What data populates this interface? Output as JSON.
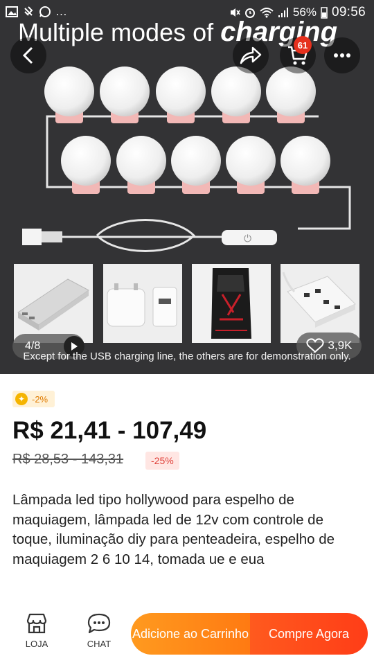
{
  "status_bar": {
    "battery": "56%",
    "time": "09:56"
  },
  "hero": {
    "title_regular": "Multiple modes of ",
    "title_bold": "charging",
    "cart_count": "61",
    "pager": "4/8",
    "likes": "3,9K",
    "caption": "Except for the USB charging line, the others are for demonstration only.",
    "switch_symbol": "⏻"
  },
  "product": {
    "coin_discount": "-2%",
    "price": "R$ 21,41 - 107,49",
    "old_price": "R$ 28,53 - 143,31",
    "discount": "-25%",
    "title": "Lâmpada led tipo hollywood para espelho de maquiagem, lâmpada led de 12v com controle de toque, iluminação diy para penteadeira, espelho de maquiagem 2 6 10 14, tomada ue e eua"
  },
  "bottom_bar": {
    "store_label": "LOJA",
    "chat_label": "CHAT",
    "add_to_cart_label": "Adicione ao Carrinho",
    "buy_now_label": "Compre Agora"
  },
  "colors": {
    "hero_background": "#333335",
    "cart_badge": "#e6311e",
    "discount_text": "#e0413a",
    "add_to_cart": "#ff8a18",
    "buy_now": "#ff4a1a"
  },
  "icons": [
    "image-icon",
    "sync-icon",
    "whatsapp-icon",
    "mute-icon",
    "alarm-icon",
    "wifi-icon",
    "signal-icon",
    "back-arrow-icon",
    "share-icon",
    "cart-icon",
    "more-icon",
    "play-icon",
    "heart-icon",
    "coin-icon",
    "store-icon",
    "chat-icon"
  ]
}
